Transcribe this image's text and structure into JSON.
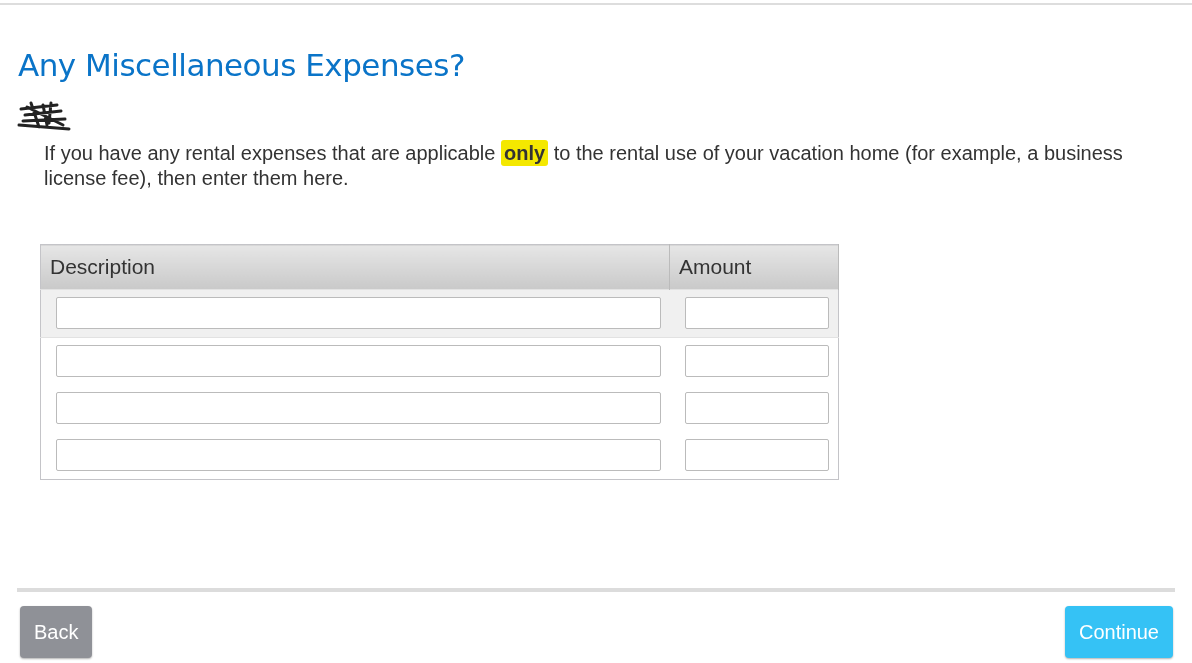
{
  "title": "Any Miscellaneous Expenses?",
  "intro": "If you have any rental expenses that are applicable **only** to the rental use of your vacation home (for example, a business license fee), then enter them here.",
  "table": {
    "columns": [
      "Description",
      "Amount"
    ],
    "rows": [
      {
        "selected": true
      },
      {
        "selected": false
      },
      {
        "selected": false
      },
      {
        "selected": false
      }
    ]
  },
  "buttons": {
    "back": "Back",
    "continue": "Continue"
  }
}
